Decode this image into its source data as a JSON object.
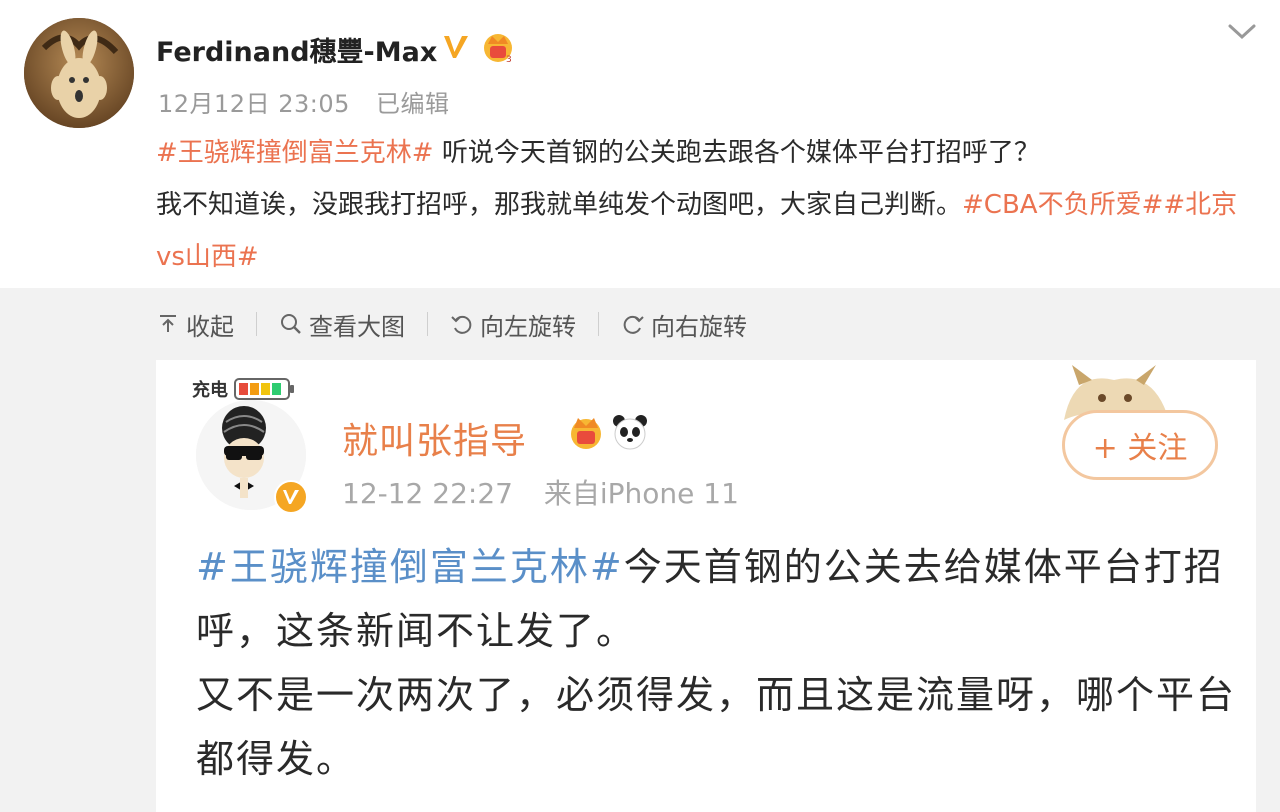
{
  "post": {
    "username": "Ferdinand穗豐-Max",
    "date": "12月12日 23:05",
    "edited": "已编辑",
    "text_parts": {
      "tag1": "#王骁辉撞倒富兰克林#",
      "line1": " 听说今天首钢的公关跑去跟各个媒体平台打招呼了？",
      "line2": "我不知道诶，没跟我打招呼，那我就单纯发个动图吧，大家自己判断。",
      "tag2": "#CBA不负所爱#",
      "tag3": "#北京vs山西#"
    },
    "colors": {
      "tag": "#eb7350",
      "text": "#2b2b2b",
      "meta": "#9a9a9a"
    }
  },
  "toolbar": {
    "collapse": "收起",
    "view_large": "查看大图",
    "rotate_left": "向左旋转",
    "rotate_right": "向右旋转"
  },
  "embedded": {
    "charge_label": "充电",
    "username": "就叫张指导",
    "date": "12-12 22:27",
    "source": "来自iPhone 11",
    "follow_label": "+ 关注",
    "text_parts": {
      "tag": "#王骁辉撞倒富兰克林#",
      "line1": "今天首钢的公关去给媒体平台打招呼，这条新闻不让发了。",
      "line2": "又不是一次两次了，必须得发，而且这是流量呀，哪个平台都得发。"
    },
    "colors": {
      "name": "#e8804a",
      "tag": "#5a8fc8"
    }
  },
  "icons": {
    "verified": "verified-v-icon",
    "crown": "crown-badge-icon",
    "panda": "panda-icon",
    "chevron": "chevron-down-icon",
    "collapse": "collapse-up-icon",
    "zoom": "magnifier-icon",
    "rotate_left": "rotate-left-icon",
    "rotate_right": "rotate-right-icon"
  }
}
